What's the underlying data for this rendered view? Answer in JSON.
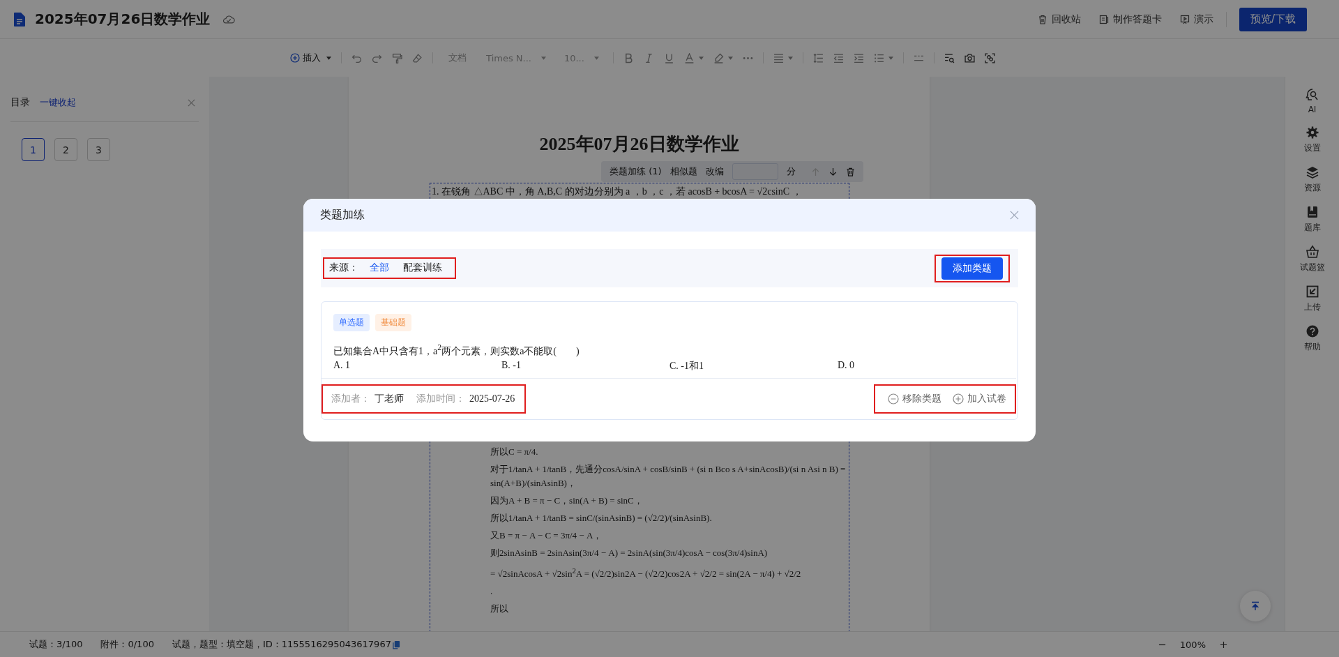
{
  "header": {
    "title": "2025年07月26日数学作业",
    "actions": [
      {
        "label": "回收站"
      },
      {
        "label": "制作答题卡"
      },
      {
        "label": "演示"
      }
    ],
    "primary_button": "预览/下载"
  },
  "toolbar": {
    "insert": "插入",
    "style": "文档",
    "font": "Times N...",
    "size": "10..."
  },
  "toc": {
    "title": "目录",
    "collapse_link": "一键收起",
    "pages": [
      {
        "label": "1",
        "selected": true
      },
      {
        "label": "2",
        "selected": false
      },
      {
        "label": "3",
        "selected": false
      }
    ]
  },
  "document": {
    "title": "2025年07月26日数学作业",
    "question_first_line": "1. 在锐角 △ABC 中，角 A,B,C 的对边分别为 a ，b ，c ，若 acosB + bcosA = √2csinC ，",
    "solution_lines": [
      "所以C = π/4.",
      "对于1/tanA + 1/tanB，先通分cosA/sinA + cosB/sinB + (si n Bco s A+sinAcosB)/(si n Asi n B) = sin(A+B)/(sinAsinB)，",
      "因为A + B = π − C，sin(A + B) = sinC，",
      "所以1/tanA + 1/tanB = sinC/(sinAsinB) = (√2/2)/(sinAsinB).",
      "又B = π − A − C = 3π/4 − A，",
      "则2sinAsinB = 2sinAsin(3π/4 − A) = 2sinA(sin(3π/4)cosA − cos(3π/4)sinA)",
      "= √2sinAcosA + √2sin$^{2}$A = (√2/2)sin2A − (√2/2)cos2A + √2/2 = sin(2A − π/4) + √2/2",
      ".",
      "所以"
    ]
  },
  "question_toolbar": {
    "items": [
      "类题加练 (1)",
      "相似题",
      "改编"
    ],
    "score_unit": "分"
  },
  "side_tools": [
    {
      "label": "AI"
    },
    {
      "label": "设置"
    },
    {
      "label": "资源"
    },
    {
      "label": "题库"
    },
    {
      "label": "试题篮"
    },
    {
      "label": "上传"
    },
    {
      "label": "帮助"
    }
  ],
  "modal": {
    "title": "类题加练",
    "source_label": "来源：",
    "source_annotated": true,
    "sources": [
      {
        "label": "全部",
        "selected": true
      },
      {
        "label": "配套训练",
        "selected": false
      }
    ],
    "add_button": "添加类题",
    "add_annotated": true,
    "card": {
      "tags": [
        {
          "label": "单选题",
          "kind": "type"
        },
        {
          "label": "基础题",
          "kind": "difficulty"
        }
      ],
      "question": "已知集合A中只含有1，a$^{2}$两个元素，则实数a不能取(　　)",
      "options": [
        "A. 1",
        "B. -1",
        "C. -1和1",
        "D. 0"
      ],
      "adder_label": "添加者：",
      "adder": "丁老师",
      "time_label": "添加时间：",
      "time": "2025-07-26",
      "info_annotated": true,
      "actions": [
        {
          "label": "移除类题",
          "kind": "remove"
        },
        {
          "label": "加入试卷",
          "kind": "add"
        }
      ],
      "actions_annotated": true
    }
  },
  "status_bar": {
    "questions": "试题：3/100",
    "attachments": "附件：0/100",
    "info": "试题，题型：填空题，ID：1155516295043617967",
    "zoom": "100%"
  }
}
